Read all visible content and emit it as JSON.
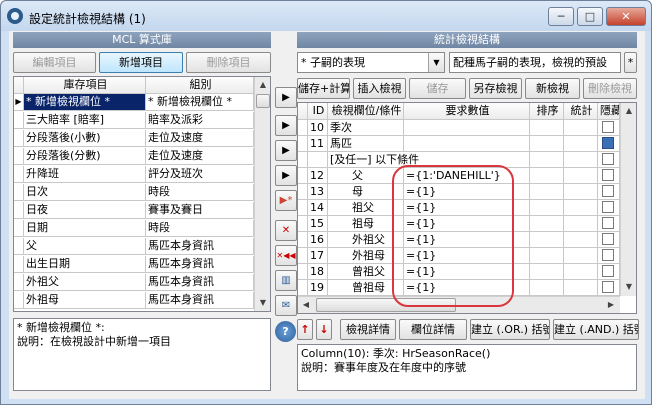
{
  "window": {
    "title": "設定統計檢視結構 (1)",
    "controls": {
      "minimize": "─",
      "maximize": "□",
      "close": "✕"
    }
  },
  "left": {
    "title": "MCL 算式庫",
    "buttons": {
      "edit": "編輯項目",
      "add": "新增項目",
      "delete": "刪除項目"
    },
    "columns": {
      "item": "庫存項目",
      "group": "組別"
    },
    "rows": [
      {
        "item": "* 新增檢視欄位 *",
        "group": "* 新增檢視欄位 *"
      },
      {
        "item": "三大賠率 [賠率]",
        "group": "賠率及派彩"
      },
      {
        "item": "分段落後(小數)",
        "group": "走位及速度"
      },
      {
        "item": "分段落後(分數)",
        "group": "走位及速度"
      },
      {
        "item": "升降班",
        "group": "評分及班次"
      },
      {
        "item": "日次",
        "group": "時段"
      },
      {
        "item": "日夜",
        "group": "賽事及賽日"
      },
      {
        "item": "日期",
        "group": "時段"
      },
      {
        "item": "父",
        "group": "馬匹本身資訊"
      },
      {
        "item": "出生日期",
        "group": "馬匹本身資訊"
      },
      {
        "item": "外祖父",
        "group": "馬匹本身資訊"
      },
      {
        "item": "外祖母",
        "group": "馬匹本身資訊"
      }
    ],
    "description": {
      "line1": "* 新增檢視欄位 *:",
      "line2": "說明：在檢視設計中新增一項目"
    }
  },
  "middle": {
    "buttons": [
      "▶",
      "▶",
      "▶",
      "▶",
      "▶*",
      "✕",
      "✕◀◀",
      "▥",
      "✉"
    ]
  },
  "right": {
    "title": "統計檢視結構",
    "selector": {
      "value": "* 子嗣的表現",
      "description": "配種馬子嗣的表現，檢視的預設",
      "side": "*"
    },
    "buttons": {
      "save_calc": "儲存+計算",
      "insert_view": "插入檢視",
      "save": "儲存",
      "save_as": "另存檢視",
      "new_view": "新檢視",
      "delete_view": "刪除檢視"
    },
    "columns": {
      "id": "ID",
      "field": "檢視欄位/條件",
      "value": "要求數值",
      "sort": "排序",
      "stat": "統計",
      "hidden": "隱藏"
    },
    "rows": [
      {
        "id": "10",
        "field": "季次",
        "value": "",
        "hidden": false
      },
      {
        "id": "11",
        "field": "馬匹",
        "value": "",
        "hidden": true
      },
      {
        "id": "",
        "field": "[及任一] 以下條件",
        "value": "",
        "hidden": false
      },
      {
        "id": "12",
        "field": "父",
        "value": "={1:'DANEHILL'}",
        "hidden": false
      },
      {
        "id": "13",
        "field": "母",
        "value": "={1}",
        "hidden": false
      },
      {
        "id": "14",
        "field": "祖父",
        "value": "={1}",
        "hidden": false
      },
      {
        "id": "15",
        "field": "祖母",
        "value": "={1}",
        "hidden": false
      },
      {
        "id": "16",
        "field": "外祖父",
        "value": "={1}",
        "hidden": false
      },
      {
        "id": "17",
        "field": "外祖母",
        "value": "={1}",
        "hidden": false
      },
      {
        "id": "18",
        "field": "曾祖父",
        "value": "={1}",
        "hidden": false
      },
      {
        "id": "19",
        "field": "曾祖母",
        "value": "={1}",
        "hidden": false
      }
    ],
    "bottom_buttons": {
      "up": "↑",
      "down": "↓",
      "view_detail": "檢視詳情",
      "field_detail": "欄位詳情",
      "or_bracket": "建立 (.OR.) 括號",
      "and_bracket": "建立 (.AND.) 括號"
    },
    "info": {
      "line1": "Column(10): 季次: HrSeasonRace()",
      "line2": "說明：賽事年度及在年度中的序號"
    }
  },
  "help": {
    "label": "?"
  }
}
